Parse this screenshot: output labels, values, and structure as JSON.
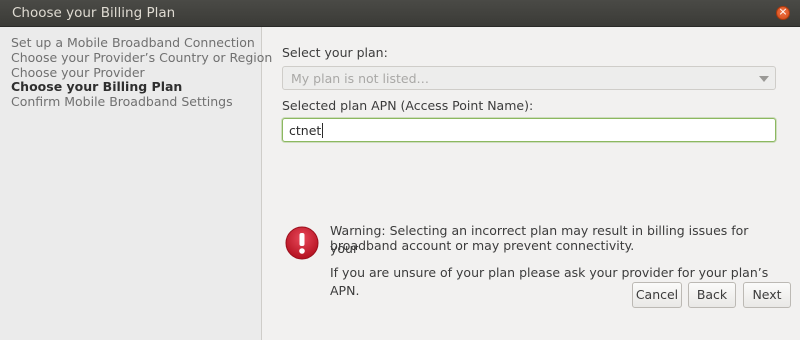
{
  "window": {
    "title": "Choose your Billing Plan",
    "close_glyph": "×"
  },
  "sidebar": {
    "steps": [
      {
        "label": "Set up a Mobile Broadband Connection",
        "active": false
      },
      {
        "label": "Choose your Provider’s Country or Region",
        "active": false
      },
      {
        "label": "Choose your Provider",
        "active": false
      },
      {
        "label": "Choose your Billing Plan",
        "active": true
      },
      {
        "label": "Confirm Mobile Broadband Settings",
        "active": false
      }
    ]
  },
  "form": {
    "plan_label": "Select your plan:",
    "plan_value": "My plan is not listed…",
    "plan_disabled": true,
    "apn_label": "Selected plan APN (Access Point Name):",
    "apn_value": "ctnet"
  },
  "warning": {
    "icon": "error-icon",
    "line1": "Warning: Selecting an incorrect plan may result in billing issues for your",
    "line2": "broadband account or may prevent connectivity.",
    "line3": "If you are unsure of your plan please ask your provider for your plan’s APN."
  },
  "buttons": {
    "cancel": "Cancel",
    "back": "Back",
    "next": "Next"
  },
  "colors": {
    "error_red": "#c7162b",
    "focus_green": "#8cb860",
    "titlebar": "#3c3b37"
  }
}
